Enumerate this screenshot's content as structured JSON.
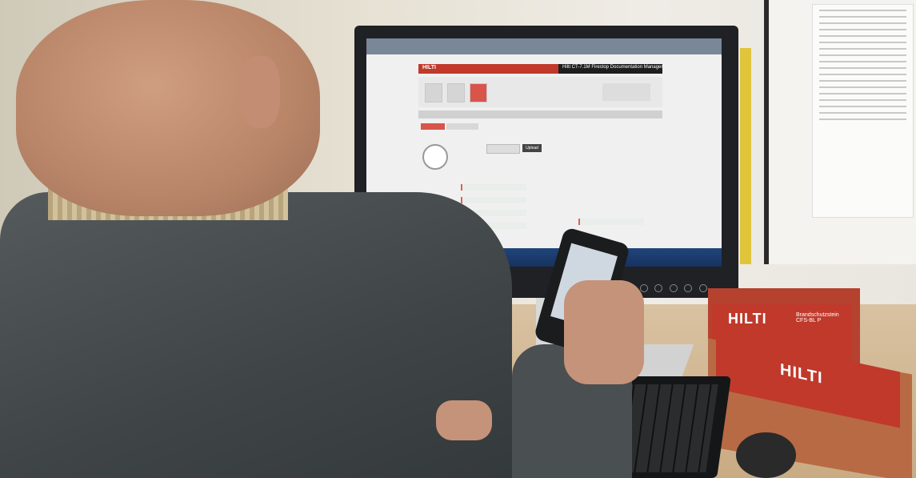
{
  "monitor_screen": {
    "brand": "HILTI",
    "app_title": "Hilti CT-7.1M Firestop Documentation Manager",
    "upload_button": "Upload"
  },
  "products": {
    "red_box_brand": "HILTI",
    "red_box_text": "Brandschutzstein CFS-BL P",
    "brown_box_brand": "HILTI"
  },
  "colors": {
    "hilti_red": "#c0392b",
    "taskbar_blue": "#1e3f72"
  }
}
